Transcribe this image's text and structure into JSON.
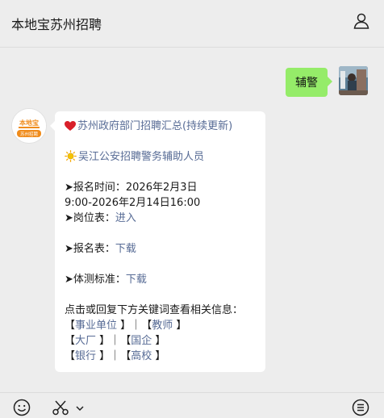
{
  "header": {
    "title": "本地宝苏州招聘",
    "user_icon": "user-icon"
  },
  "outgoing": {
    "text": "辅警"
  },
  "incoming": {
    "avatar_brand_text": "本地宝",
    "avatar_sub_text": "苏州招聘",
    "title": "苏州政府部门招聘汇总(持续更新)",
    "item_title": "吴江公安招聘警务辅助人员",
    "time_label": "➤报名时间：2026年2月3日",
    "time_range": "9:00-2026年2月14日16:00",
    "post_label": "➤岗位表：",
    "post_link": "进入",
    "form_label": "➤报名表：",
    "form_link": "下载",
    "fitness_label": "➤体测标准：",
    "fitness_link": "下载",
    "keywords_intro": "点击或回复下方关键词查看相关信息：",
    "kw_open": "【",
    "kw_close": "】",
    "kw_sep": "｜",
    "kw1": "事业单位",
    "kw2": "教师",
    "kw3": "大厂",
    "kw4": "国企",
    "kw5": "银行",
    "kw6": "高校"
  },
  "colors": {
    "bubble_green": "#95ec69",
    "link_blue": "#576b95",
    "background": "#ededed",
    "brand_orange": "#f08c1c"
  },
  "bottombar": {
    "icons": [
      "emoji-icon",
      "scissors-icon",
      "chevron-down-icon",
      "menu-list-icon"
    ]
  }
}
